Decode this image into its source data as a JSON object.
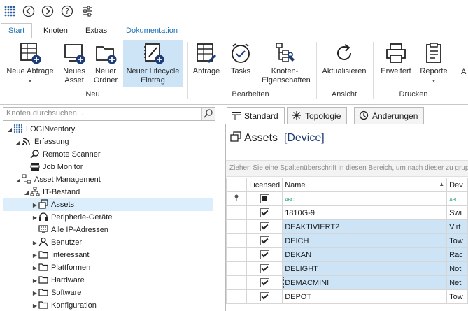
{
  "menu": {
    "tabs": [
      "Start",
      "Knoten",
      "Extras",
      "Dokumentation"
    ]
  },
  "ribbon": {
    "neu": {
      "label": "Neu",
      "buttons": [
        "Neue Abfrage",
        "Neues Asset",
        "Neuer Ordner",
        "Neuer Lifecycle Eintrag"
      ]
    },
    "bearbeiten": {
      "label": "Bearbeiten",
      "buttons": [
        "Abfrage",
        "Tasks",
        "Knoten-Eigenschaften"
      ]
    },
    "ansicht": {
      "label": "Ansicht",
      "buttons": [
        "Aktualisieren"
      ]
    },
    "drucken": {
      "label": "Drucken",
      "buttons": [
        "Erweitert",
        "Reporte"
      ]
    },
    "cut_group_label": "A"
  },
  "search": {
    "placeholder": "Knoten durchsuchen..."
  },
  "tree": {
    "root": "LOGINventory",
    "erfassung": "Erfassung",
    "remote_scanner": "Remote Scanner",
    "job_monitor": "Job Monitor",
    "asset_management": "Asset Management",
    "it_bestand": "IT-Bestand",
    "assets": "Assets",
    "peripherie": "Peripherie-Geräte",
    "ip_adressen": "Alle IP-Adressen",
    "benutzer": "Benutzer",
    "interessant": "Interessant",
    "plattformen": "Plattformen",
    "hardware": "Hardware",
    "software": "Software",
    "konfiguration": "Konfiguration"
  },
  "view_tabs": [
    "Standard",
    "Topologie",
    "Änderungen"
  ],
  "content": {
    "title": "Assets",
    "subtitle": "[Device]",
    "group_hint": "Ziehen Sie eine Spaltenüberschrift in diesen Bereich, um nach dieser zu gruppieren",
    "columns": [
      "Licensed",
      "Name",
      "Dev"
    ],
    "filter_abc": "ABC",
    "rows": [
      {
        "name": "1810G-9",
        "device": "Swi",
        "licensed": true,
        "highlight": false
      },
      {
        "name": "DEAKTIVIERT2",
        "device": "Virt",
        "licensed": true,
        "highlight": true
      },
      {
        "name": "DEICH",
        "device": "Tow",
        "licensed": true,
        "highlight": true
      },
      {
        "name": "DEKAN",
        "device": "Rac",
        "licensed": true,
        "highlight": true
      },
      {
        "name": "DELIGHT",
        "device": "Not",
        "licensed": true,
        "highlight": true
      },
      {
        "name": "DEMACMINI",
        "device": "Net",
        "licensed": true,
        "highlight": true
      },
      {
        "name": "DEPOT",
        "device": "Tow",
        "licensed": true,
        "highlight": false
      }
    ]
  },
  "colors": {
    "accent": "#1a6fb5",
    "selection": "#cde4f7"
  }
}
